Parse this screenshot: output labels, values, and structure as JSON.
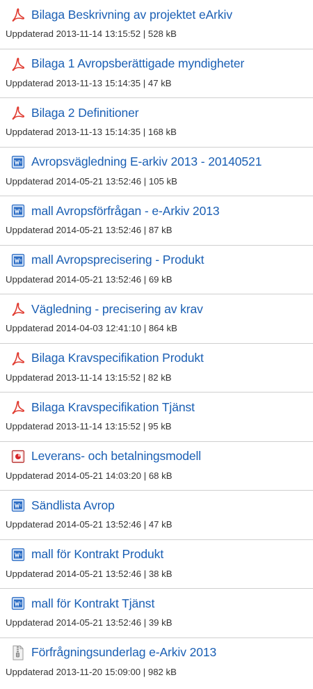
{
  "meta_prefix": "Uppdaterad",
  "separator": "|",
  "files": [
    {
      "title": "Bilaga Beskrivning av projektet eArkiv",
      "icon": "pdf-icon",
      "updated": "2013-11-14 13:15:52",
      "size": "528 kB"
    },
    {
      "title": "Bilaga 1 Avropsberättigade myndigheter",
      "icon": "pdf-icon",
      "updated": "2013-11-13 15:14:35",
      "size": "47 kB"
    },
    {
      "title": "Bilaga 2 Definitioner",
      "icon": "pdf-icon",
      "updated": "2013-11-13 15:14:35",
      "size": "168 kB"
    },
    {
      "title": "Avropsvägledning E-arkiv 2013 - 20140521",
      "icon": "word-doc-icon",
      "updated": "2014-05-21 13:52:46",
      "size": "105 kB"
    },
    {
      "title": "mall Avropsförfrågan - e-Arkiv 2013",
      "icon": "word-doc-icon",
      "updated": "2014-05-21 13:52:46",
      "size": "87 kB"
    },
    {
      "title": "mall Avropsprecisering - Produkt",
      "icon": "word-doc-icon",
      "updated": "2014-05-21 13:52:46",
      "size": "69 kB"
    },
    {
      "title": "Vägledning - precisering av krav",
      "icon": "pdf-icon",
      "updated": "2014-04-03 12:41:10",
      "size": "864 kB"
    },
    {
      "title": "Bilaga Kravspecifikation Produkt",
      "icon": "pdf-icon",
      "updated": "2013-11-14 13:15:52",
      "size": "82 kB"
    },
    {
      "title": "Bilaga Kravspecifikation Tjänst",
      "icon": "pdf-icon",
      "updated": "2013-11-14 13:15:52",
      "size": "95 kB"
    },
    {
      "title": "Leverans- och betalningsmodell",
      "icon": "powerpoint-icon",
      "updated": "2014-05-21 14:03:20",
      "size": "68 kB"
    },
    {
      "title": "Sändlista Avrop",
      "icon": "word-doc-icon",
      "updated": "2014-05-21 13:52:46",
      "size": "47 kB"
    },
    {
      "title": "mall för Kontrakt Produkt",
      "icon": "word-doc-icon",
      "updated": "2014-05-21 13:52:46",
      "size": "38 kB"
    },
    {
      "title": "mall för Kontrakt Tjänst",
      "icon": "word-doc-icon",
      "updated": "2014-05-21 13:52:46",
      "size": "39 kB"
    },
    {
      "title": "Förfrågningsunderlag e-Arkiv 2013",
      "icon": "zip-archive-icon",
      "updated": "2013-11-20 15:09:00",
      "size": "982 kB"
    }
  ],
  "colors": {
    "link": "#1a5fb4",
    "meta_text": "#333333",
    "divider": "#cfcfcf",
    "pdf_red": "#e03a2f",
    "word_blue": "#2b6cc4",
    "ppt_red": "#d8262b"
  }
}
